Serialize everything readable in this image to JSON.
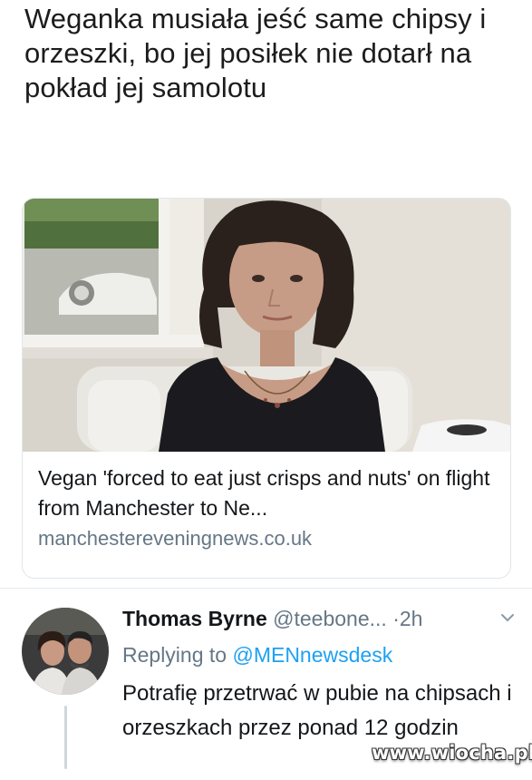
{
  "headline": "Weganka musiała jeść same chipsy i orzeszki, bo jej posiłek nie dotarł na pokład jej samolotu",
  "link_card": {
    "title": "Vegan 'forced to eat just crisps and nuts' on flight from Manchester to Ne...",
    "domain": "manchestereveningnews.co.uk"
  },
  "tweet": {
    "author_name": "Thomas Byrne",
    "handle": "@teebone...",
    "separator": "·",
    "time": "2h",
    "replying_prefix": "Replying to",
    "replying_to": "@MENnewsdesk",
    "text": "Potrafię przetrwać w pubie na chipsach i orzeszkach przez ponad 12 godzin"
  },
  "watermark": "www.wiocha.pl",
  "colors": {
    "link": "#1da1f2",
    "secondary_text": "#657786",
    "text": "#14171a"
  }
}
